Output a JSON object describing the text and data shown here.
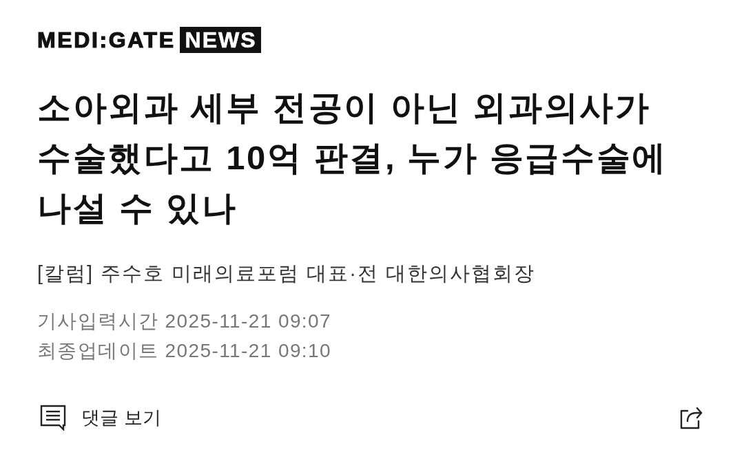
{
  "logo": {
    "brand": "MEDI:GATE",
    "section": "NEWS"
  },
  "article": {
    "title": "소아외과 세부 전공이 아닌 외과의사가 수술했다고 10억 판결, 누가 응급수술에 나설 수 있나",
    "byline": "[칼럼] 주수호 미래의료포럼 대표·전 대한의사협회장",
    "timestamps": [
      {
        "label": "기사입력시간",
        "value": "2025-11-21 09:07"
      },
      {
        "label": "최종업데이트",
        "value": "2025-11-21 09:10"
      }
    ]
  },
  "footer": {
    "comments_label": "댓글 보기"
  }
}
